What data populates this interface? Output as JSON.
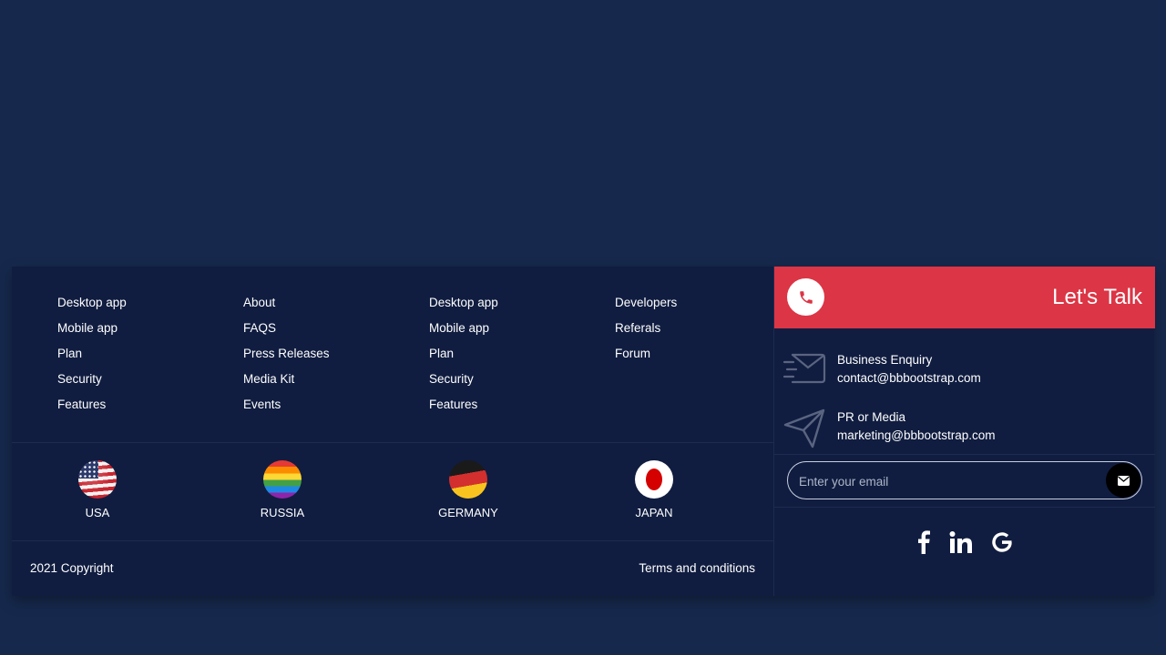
{
  "columns": [
    [
      "Desktop app",
      "Mobile app",
      "Plan",
      "Security",
      "Features"
    ],
    [
      "About",
      "FAQS",
      "Press Releases",
      "Media Kit",
      "Events"
    ],
    [
      "Desktop app",
      "Mobile app",
      "Plan",
      "Security",
      "Features"
    ],
    [
      "Developers",
      "Referals",
      "Forum"
    ]
  ],
  "countries": [
    {
      "name": "USA",
      "flag": "usa-flag-icon"
    },
    {
      "name": "RUSSIA",
      "flag": "rainbow-flag-icon"
    },
    {
      "name": "GERMANY",
      "flag": "germany-flag-icon"
    },
    {
      "name": "JAPAN",
      "flag": "japan-flag-icon"
    }
  ],
  "bottom": {
    "copyright": "2021 Copyright",
    "terms": "Terms and conditions"
  },
  "talk": {
    "title": "Let's Talk",
    "accent": "#dc3545",
    "contacts": [
      {
        "label": "Business Enquiry",
        "value": "contact@bbbootstrap.com",
        "icon": "envelope-outline-icon"
      },
      {
        "label": "PR or Media",
        "value": "marketing@bbbootstrap.com",
        "icon": "paper-plane-icon"
      }
    ],
    "email_placeholder": "Enter your email",
    "social": [
      "facebook-icon",
      "linkedin-icon",
      "google-icon"
    ]
  },
  "colors": {
    "page_background": "#16294d",
    "footer_background": "#101d40"
  }
}
